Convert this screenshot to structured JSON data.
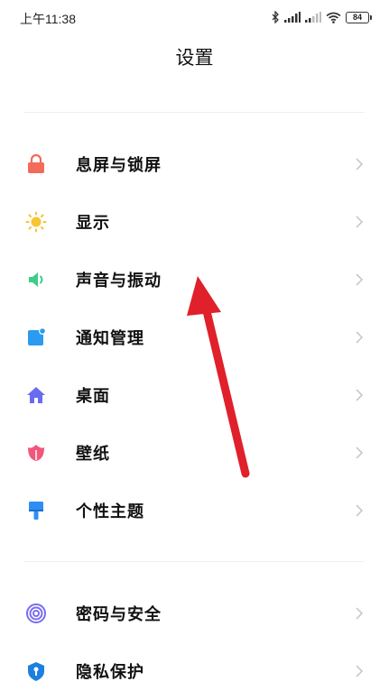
{
  "status_bar": {
    "time": "上午11:38",
    "battery": "84"
  },
  "header": {
    "title": "设置"
  },
  "menu": {
    "group1": [
      {
        "label": "息屏与锁屏",
        "icon": "lock-icon",
        "color": "#f26b5b"
      },
      {
        "label": "显示",
        "icon": "sun-icon",
        "color": "#f7c531"
      },
      {
        "label": "声音与振动",
        "icon": "speaker-icon",
        "color": "#3fcb88"
      },
      {
        "label": "通知管理",
        "icon": "notification-icon",
        "color": "#2a9bf0"
      },
      {
        "label": "桌面",
        "icon": "home-icon",
        "color": "#6a6cf0"
      },
      {
        "label": "壁纸",
        "icon": "tulip-icon",
        "color": "#f2567a"
      },
      {
        "label": "个性主题",
        "icon": "paintbrush-icon",
        "color": "#2f8ef5"
      }
    ],
    "group2": [
      {
        "label": "密码与安全",
        "icon": "fingerprint-icon",
        "color": "#7a6cf2"
      },
      {
        "label": "隐私保护",
        "icon": "privacy-icon",
        "color": "#1d7fe0"
      }
    ]
  },
  "annotation": {
    "arrow_color": "#e0202a"
  }
}
